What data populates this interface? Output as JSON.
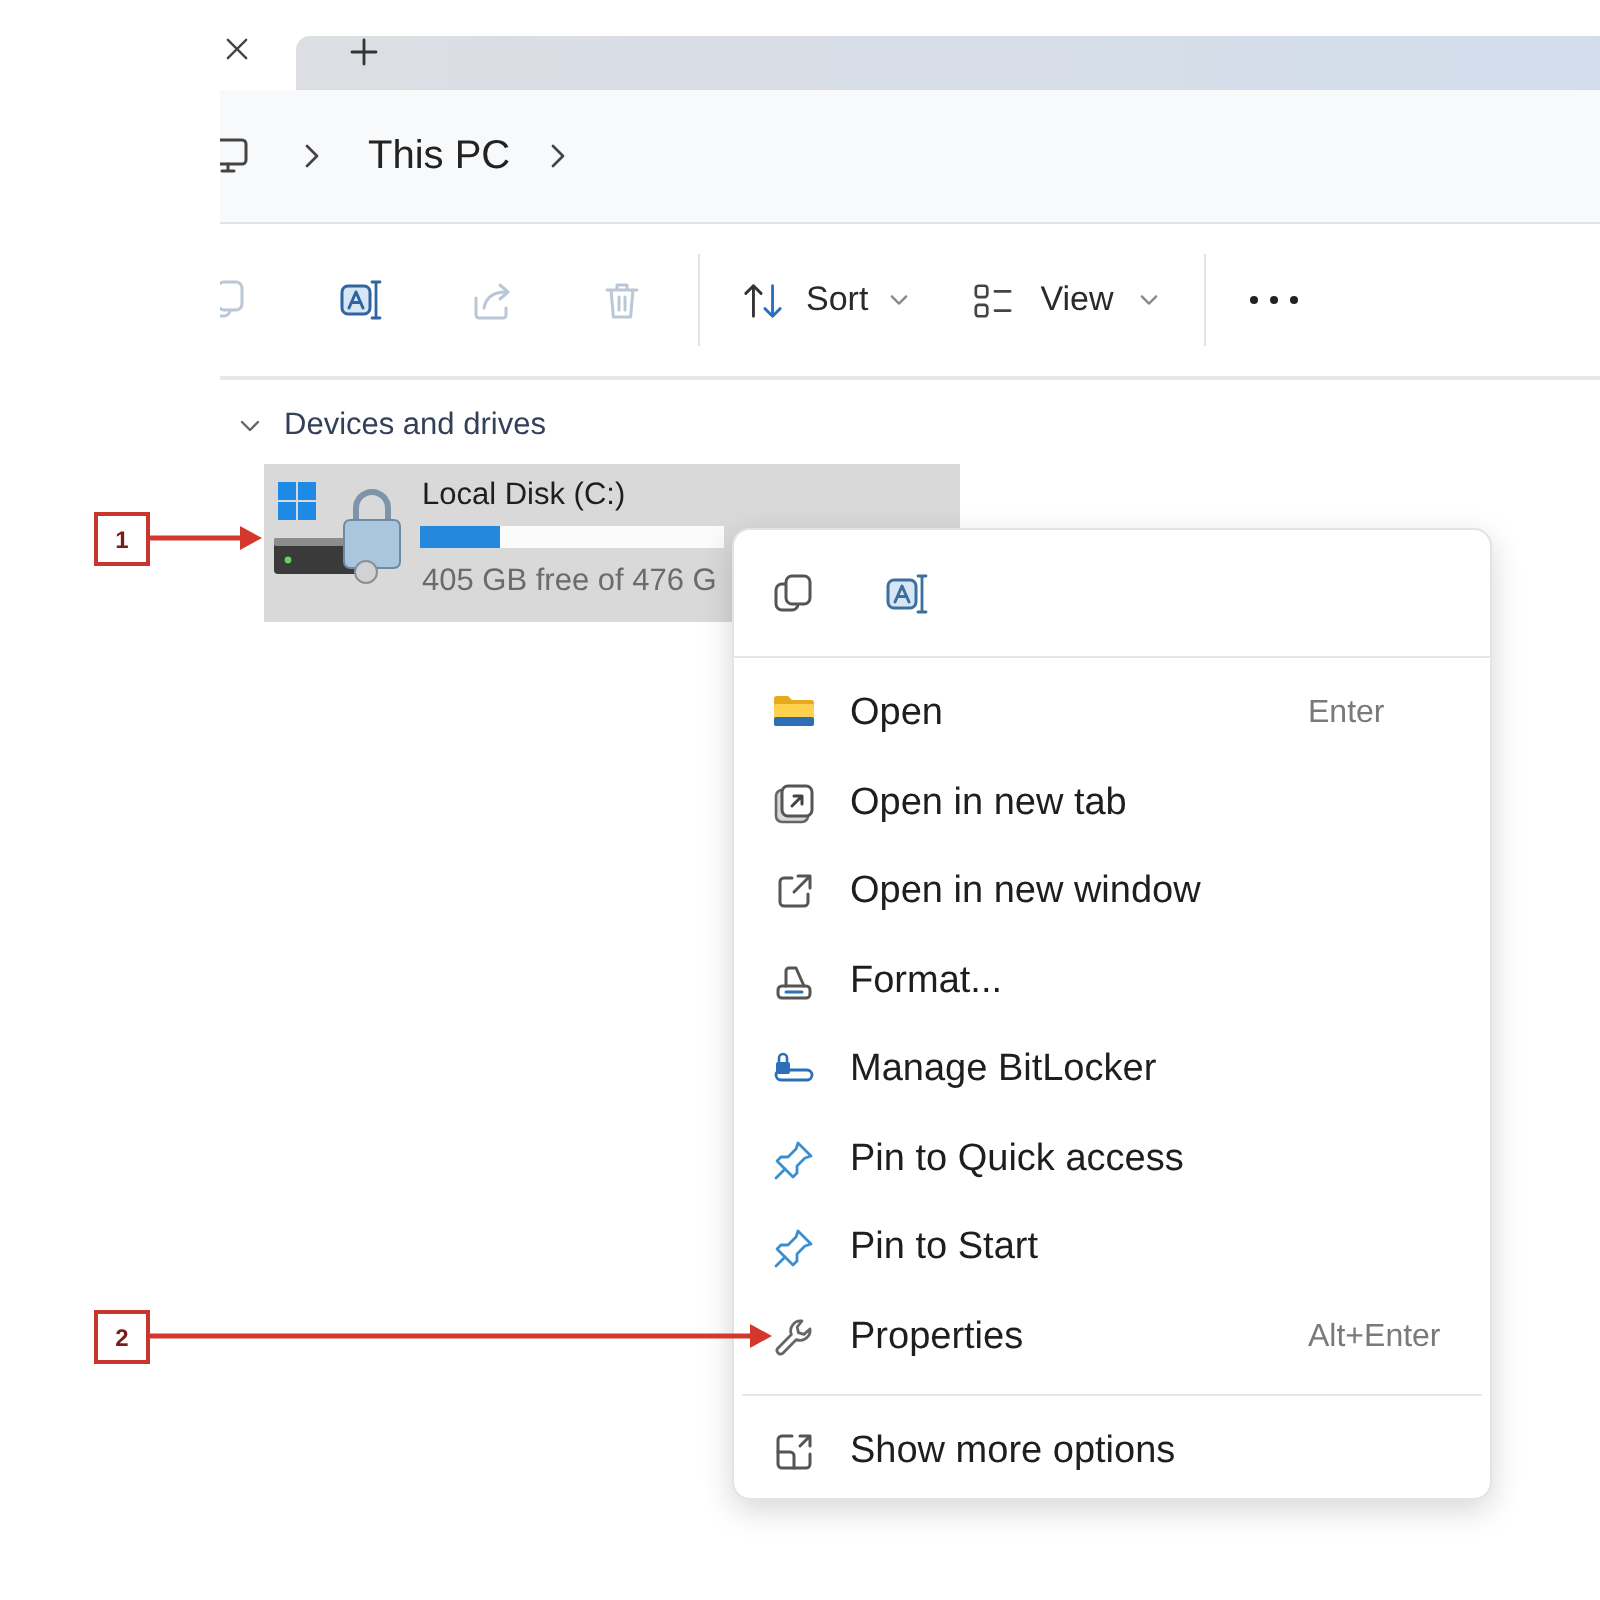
{
  "address_bar": {
    "crumbs": [
      "This PC"
    ]
  },
  "toolbar": {
    "icon_buttons": [
      {
        "disabled": true
      },
      {
        "disabled": false
      },
      {
        "disabled": true
      },
      {
        "disabled": true
      }
    ],
    "sort": {
      "label": "Sort"
    },
    "view": {
      "label": "View"
    }
  },
  "sections": [
    {
      "title": "Devices and drives",
      "expanded": true,
      "drives": [
        {
          "name": "Local Disk (C:)",
          "level": 0.26,
          "free_text": "405 GB free of 476 G",
          "selected": true
        }
      ]
    }
  ],
  "context_menu": {
    "items": [
      {
        "label": "Open",
        "shortcut": "Enter"
      },
      {
        "label": "Open in new tab"
      },
      {
        "label": "Open in new window"
      },
      {
        "label": "Format..."
      },
      {
        "label": "Manage BitLocker"
      },
      {
        "label": "Pin to Quick access"
      },
      {
        "label": "Pin to Start"
      },
      {
        "label": "Properties",
        "shortcut": "Alt+Enter"
      }
    ],
    "footer_items": [
      {
        "label": "Show more options"
      }
    ]
  },
  "callouts": [
    {
      "label": "1"
    },
    {
      "label": "2"
    }
  ]
}
